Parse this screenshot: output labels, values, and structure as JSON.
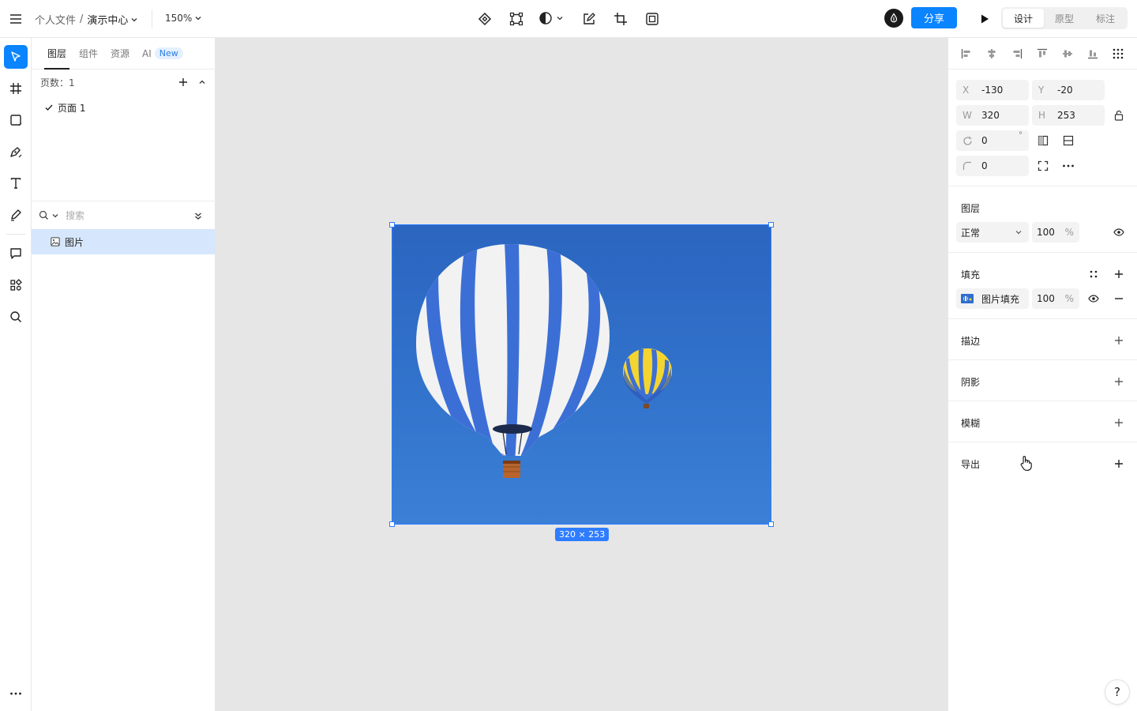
{
  "topbar": {
    "breadcrumb_root": "个人文件",
    "breadcrumb_sep": "/",
    "breadcrumb_current": "演示中心",
    "zoom": "150%",
    "share_label": "分享",
    "modes": [
      "设计",
      "原型",
      "标注"
    ],
    "active_mode": "设计"
  },
  "rail": {
    "tools": [
      "move-tool",
      "frame-tool",
      "rectangle-tool",
      "pen-tool",
      "text-tool",
      "pencil-tool",
      "comment-tool",
      "plugins-tool",
      "search-tool"
    ]
  },
  "layers_panel": {
    "tabs": [
      "图层",
      "组件",
      "资源",
      "AI"
    ],
    "active_tab": "图层",
    "ai_badge": "New",
    "pages_label": "页数：1",
    "page_name": "页面 1",
    "search_placeholder": "搜索",
    "layer_name": "图片"
  },
  "canvas": {
    "selection_size": "320 × 253",
    "background": "#e6e6e6",
    "selection_color": "#2f7dff"
  },
  "inspector": {
    "x_label": "X",
    "x_value": "-130",
    "y_label": "Y",
    "y_value": "-20",
    "w_label": "W",
    "w_value": "320",
    "h_label": "H",
    "h_value": "253",
    "rotation": "0",
    "rotation_unit": "°",
    "radius": "0",
    "layer_title": "图层",
    "blend_mode": "正常",
    "layer_opacity": "100",
    "percent": "%",
    "fill_title": "填充",
    "fill_type": "图片填充",
    "fill_opacity": "100",
    "stroke_title": "描边",
    "shadow_title": "阴影",
    "blur_title": "模糊",
    "export_title": "导出"
  },
  "help_label": "?",
  "colors": {
    "accent": "#0a84ff",
    "selected_row": "#d6e6fc"
  }
}
